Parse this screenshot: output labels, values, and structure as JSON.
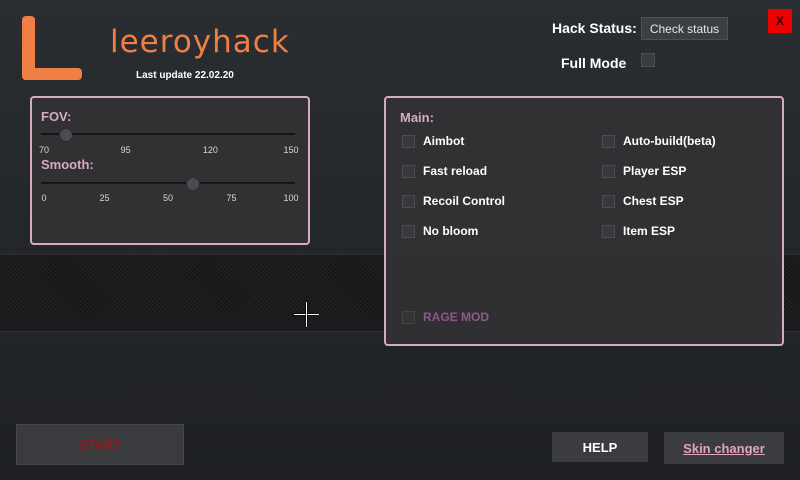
{
  "app": {
    "logo_text": "leeroyhack",
    "last_update": "Last update 22.02.20"
  },
  "header": {
    "hack_status_label": "Hack Status:",
    "check_status_label": "Check status",
    "full_mode_label": "Full Mode",
    "full_mode_checked": false,
    "close_label": "X"
  },
  "sliders": {
    "fov": {
      "label": "FOV:",
      "min": 70,
      "max": 150,
      "value": 78,
      "ticks": [
        "70",
        "95",
        "120",
        "150"
      ]
    },
    "smooth": {
      "label": "Smooth:",
      "min": 0,
      "max": 100,
      "value": 60,
      "ticks": [
        "0",
        "25",
        "50",
        "75",
        "100"
      ]
    }
  },
  "main": {
    "title": "Main:",
    "left_options": [
      {
        "label": "Aimbot",
        "checked": false
      },
      {
        "label": "Fast reload",
        "checked": false
      },
      {
        "label": "Recoil Control",
        "checked": false
      },
      {
        "label": "No bloom",
        "checked": false
      }
    ],
    "right_options": [
      {
        "label": "Auto-build(beta)",
        "checked": false
      },
      {
        "label": "Player ESP",
        "checked": false
      },
      {
        "label": "Chest ESP",
        "checked": false
      },
      {
        "label": "Item ESP",
        "checked": false
      }
    ],
    "rage_mod": {
      "label": "RAGE MOD",
      "checked": false
    }
  },
  "footer": {
    "start_label": "START",
    "help_label": "HELP",
    "skin_changer_label": "Skin changer"
  },
  "colors": {
    "accent_orange": "#ef7f45",
    "accent_pink": "#d6a9c6",
    "close_red": "#ef0000",
    "start_text": "#8f1d1d"
  }
}
